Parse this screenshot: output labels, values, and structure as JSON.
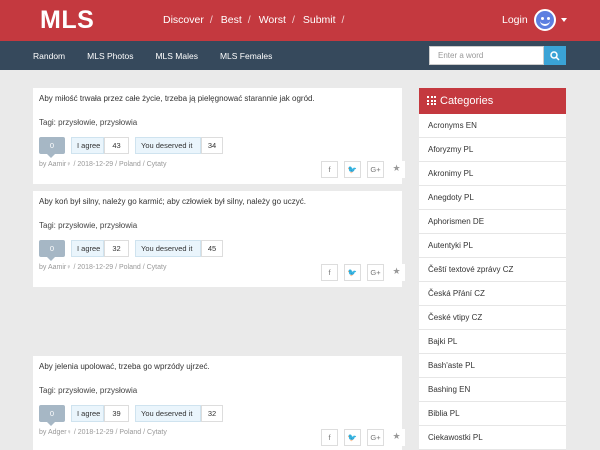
{
  "brand": {
    "logo": "MLS",
    "accent": "#c4393f",
    "subbar": "#36495c"
  },
  "topnav": [
    {
      "label": "Discover",
      "sep": "/"
    },
    {
      "label": "Best",
      "sep": "/"
    },
    {
      "label": "Worst",
      "sep": "/"
    },
    {
      "label": "Submit",
      "sep": "/"
    }
  ],
  "user": {
    "login_label": "Login",
    "avatar_icon": "smiley-avatar-icon"
  },
  "subnav": [
    "Random",
    "MLS Photos",
    "MLS Males",
    "MLS Females"
  ],
  "search": {
    "placeholder": "Enter a word",
    "button_icon": "search-icon"
  },
  "posts": [
    {
      "text": "Aby miłość trwała przez całe życie, trzeba ją pielęgnować starannie jak ogród.",
      "tags": "Tagi: przysłowie, przysłowia",
      "votes": "0",
      "agree_label": "I agree",
      "agree_count": "43",
      "deserved_label": "You deserved it",
      "deserved_count": "34",
      "by": "by Aamir",
      "date": "/ 2018-12-29 /",
      "country": "Poland",
      "category": "/ Cytaty"
    },
    {
      "text": "Aby koń był silny, należy go karmić; aby człowiek był silny, należy go uczyć.",
      "tags": "Tagi: przysłowie, przysłowia",
      "votes": "0",
      "agree_label": "I agree",
      "agree_count": "32",
      "deserved_label": "You deserved it",
      "deserved_count": "45",
      "by": "by Aamir",
      "date": "/ 2018-12-29 /",
      "country": "Poland",
      "category": "/ Cytaty"
    },
    {
      "text": "Aby jelenia upolować, trzeba go wprzódy ujrzeć.",
      "tags": "Tagi: przysłowie, przysłowia",
      "votes": "0",
      "agree_label": "I agree",
      "agree_count": "39",
      "deserved_label": "You deserved it",
      "deserved_count": "32",
      "by": "by Adger",
      "date": "/ 2018-12-29 /",
      "country": "Poland",
      "category": "/ Cytaty"
    }
  ],
  "share": {
    "fb": "f",
    "tw": "🐦",
    "gp": "G+",
    "star": "★"
  },
  "categories": {
    "title": "Categories",
    "items": [
      "Acronyms EN",
      "Aforyzmy PL",
      "Akronimy PL",
      "Anegdoty PL",
      "Aphorismen DE",
      "Autentyki PL",
      "Čeští textové zprávy CZ",
      "Česká Přání CZ",
      "České vtipy CZ",
      "Bajki PL",
      "Bash'aste PL",
      "Bashing EN",
      "Biblia PL",
      "Ciekawostki PL"
    ]
  }
}
